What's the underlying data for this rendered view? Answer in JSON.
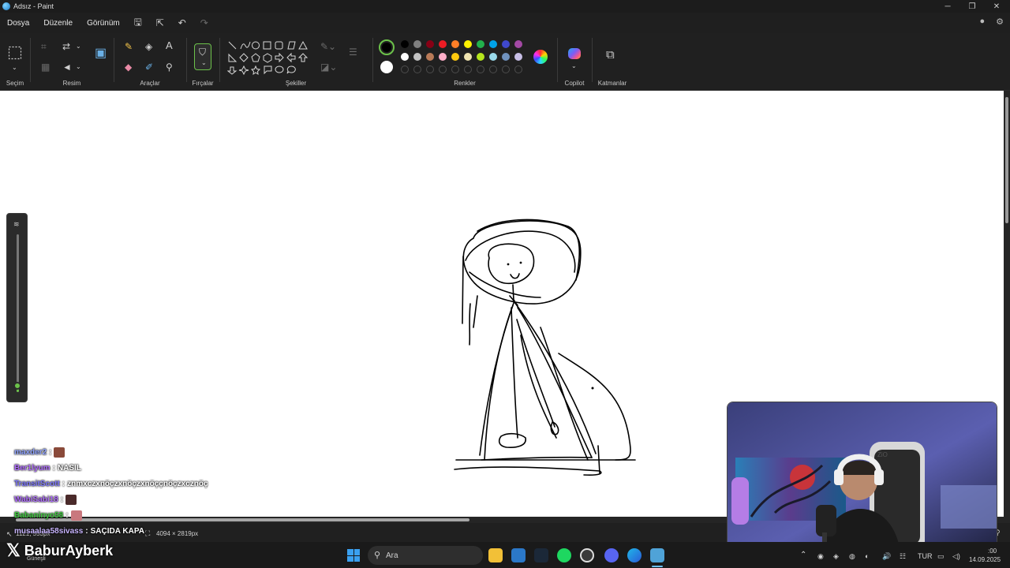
{
  "window": {
    "title": "Adsız - Paint"
  },
  "menu": {
    "file": "Dosya",
    "edit": "Düzenle",
    "view": "Görünüm"
  },
  "ribbon": {
    "selection": "Seçim",
    "image": "Resim",
    "tools": "Araçlar",
    "brushes": "Fırçalar",
    "shapes": "Şekiller",
    "colors": "Renkler",
    "copilot": "Copilot",
    "layers": "Katmanlar",
    "palette_row1": [
      "#000000",
      "#7f7f7f",
      "#880015",
      "#ed1c24",
      "#ff7f27",
      "#fff200",
      "#22b14c",
      "#00a2e8",
      "#3f48cc",
      "#a349a4"
    ],
    "palette_row2": [
      "#ffffff",
      "#c3c3c3",
      "#b97a57",
      "#ffaec9",
      "#ffc90e",
      "#efe4b0",
      "#b5e61d",
      "#99d9ea",
      "#7092be",
      "#c8bfe7"
    ],
    "primary_color": "#000000",
    "secondary_color": "#ffffff"
  },
  "brush_size_slider": {
    "value_fraction": 0.04
  },
  "status": {
    "cursor_pos": "1121, 553px",
    "canvas_size": "4094 × 2819px"
  },
  "chat": [
    {
      "user": "maxder2",
      "sep": " :",
      "msg": "",
      "color": "#8fa3ff",
      "emote": true
    },
    {
      "user": "Ber1lyum",
      "sep": " :",
      "msg": "NASIL",
      "color": "#b06cff",
      "emote": false
    },
    {
      "user": "TransitScott",
      "sep": " :",
      "msg": "znmxczxnöçzxnöçzxnöççnöçzxcznöç",
      "color": "#7e78ff",
      "emote": false
    },
    {
      "user": "WabiSabi18",
      "sep": " :",
      "msg": "",
      "color": "#b06cff",
      "emote": true
    },
    {
      "user": "Babaninyo58",
      "sep": " :",
      "msg": "",
      "color": "#3ec93e",
      "emote": true
    },
    {
      "user": "musaalaa58sivass",
      "sep": " :",
      "msg": "SAÇIDA KAPA",
      "color": "#c9b5ff",
      "emote": false
    }
  ],
  "streamer": {
    "handle": "BaburAyberk",
    "weather": "Güneşli"
  },
  "taskbar": {
    "search_placeholder": "Ara",
    "tray_lang": "TUR",
    "time": ":00",
    "date": "14.09.2025",
    "cam_text": "ZiO"
  }
}
